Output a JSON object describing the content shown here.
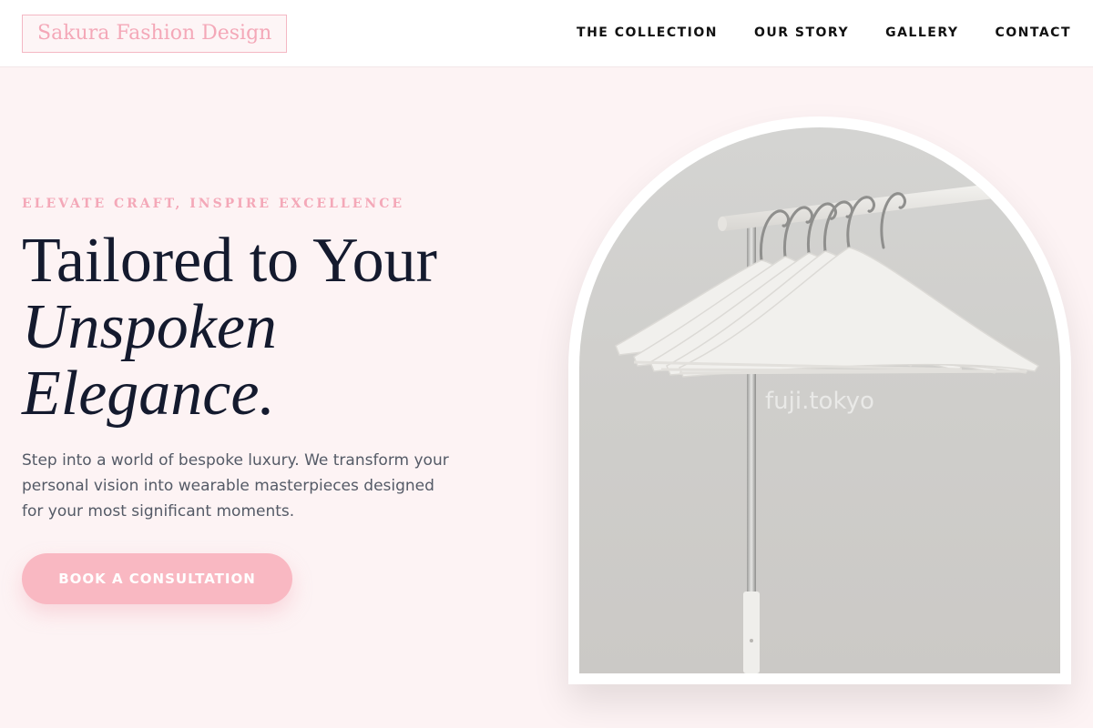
{
  "brand": {
    "name": "Sakura Fashion Design"
  },
  "nav": {
    "items": [
      {
        "label": "THE COLLECTION"
      },
      {
        "label": "OUR STORY"
      },
      {
        "label": "GALLERY"
      },
      {
        "label": "CONTACT"
      }
    ]
  },
  "hero": {
    "eyebrow": "ELEVATE CRAFT, INSPIRE EXCELLENCE",
    "headline": {
      "line1": "Tailored to Your",
      "line2": "Unspoken",
      "line3": "Elegance."
    },
    "lead": "Step into a world of bespoke luxury. We transform your personal vision into wearable masterpieces designed for your most significant moments.",
    "cta_label": "BOOK A CONSULTATION"
  },
  "image": {
    "watermark": "fuji.tokyo",
    "icon": "clothes-rack-with-hangers"
  },
  "colors": {
    "accent_pink": "#f9b8c2",
    "brand_pink": "#f4a8b8",
    "heading_navy": "#141a2e",
    "page_background": "#fdf3f4"
  }
}
